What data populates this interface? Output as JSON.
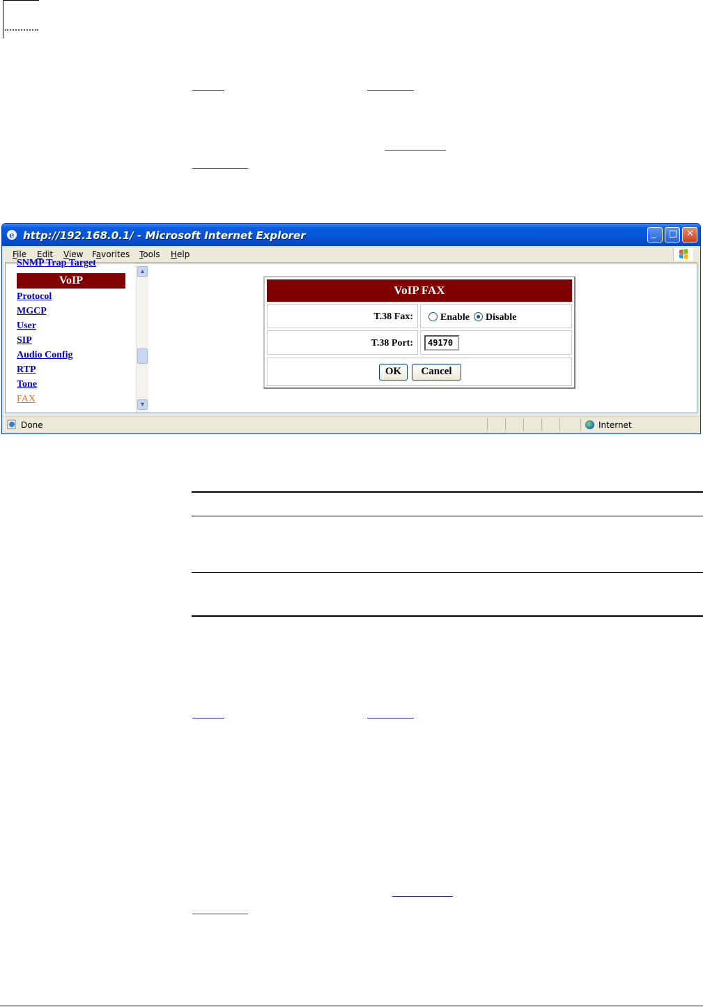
{
  "browser": {
    "title": "http://192.168.0.1/ - Microsoft Internet Explorer",
    "menu": [
      {
        "label": "File",
        "accel": "F",
        "rest": "ile"
      },
      {
        "label": "Edit",
        "accel": "E",
        "rest": "dit"
      },
      {
        "label": "View",
        "accel": "V",
        "rest": "iew"
      },
      {
        "label": "Favorites",
        "accel": "a",
        "pre": "F",
        "rest": "vorites"
      },
      {
        "label": "Tools",
        "accel": "T",
        "rest": "ools"
      },
      {
        "label": "Help",
        "accel": "H",
        "rest": "elp"
      }
    ],
    "status": {
      "text": "Done",
      "zone": "Internet"
    }
  },
  "nav": {
    "clipped_top": "SNMP Trap Target",
    "section": "VoIP",
    "items": [
      "Protocol",
      "MGCP",
      "User",
      "SIP",
      "Audio Config",
      "RTP",
      "Tone",
      "FAX"
    ],
    "active": "FAX"
  },
  "fax_form": {
    "title": "VoIP FAX",
    "t38_fax_label": "T.38 Fax:",
    "enable_label": "Enable",
    "disable_label": "Disable",
    "selected": "Disable",
    "t38_port_label": "T.38 Port:",
    "t38_port_value": "49170",
    "ok_label": "OK",
    "cancel_label": "Cancel"
  },
  "colors": {
    "header_bg": "#800000",
    "link": "#0000cc",
    "active_link": "#f07020"
  }
}
